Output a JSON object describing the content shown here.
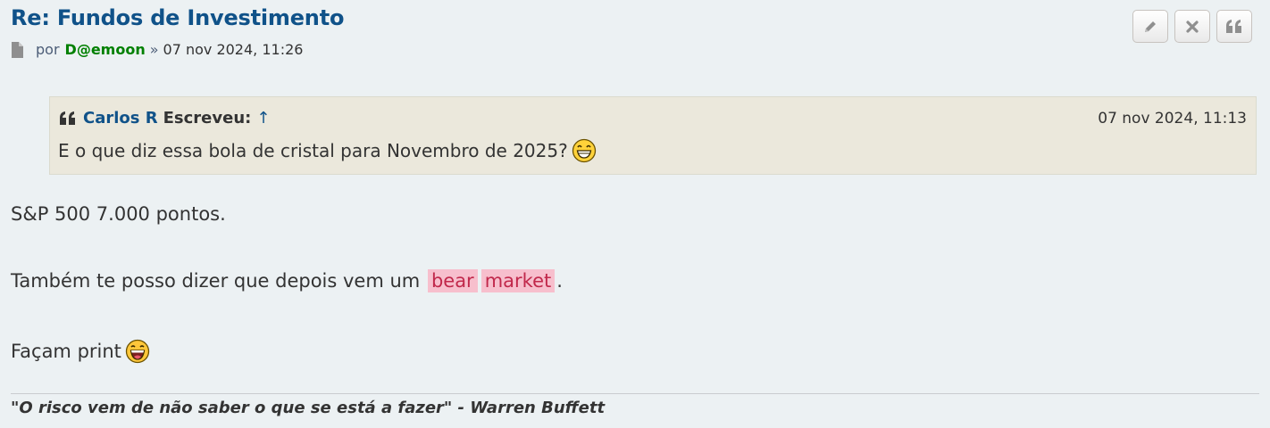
{
  "post": {
    "title": "Re: Fundos de Investimento",
    "meta": {
      "icon": "document-icon",
      "by_label": "por",
      "author": "D@emoon",
      "separator": "»",
      "date": "07 nov 2024, 11:26"
    },
    "actions": [
      {
        "name": "edit",
        "icon": "pencil-icon"
      },
      {
        "name": "delete",
        "icon": "close-icon"
      },
      {
        "name": "quote",
        "icon": "quote-icon"
      }
    ],
    "quote": {
      "icon": "quote-icon",
      "author": "Carlos R",
      "wrote_label": "Escreveu:",
      "arrow": "↑",
      "date": "07 nov 2024, 11:13",
      "text": "E o que diz essa bola de cristal para Novembro de 2025?",
      "smiley": "grin-smiley-icon"
    },
    "body": {
      "line1": "S&P 500 7.000 pontos.",
      "line2_prefix": "Também te posso dizer que depois vem um",
      "highlight1": "bear",
      "highlight2": "market",
      "line2_suffix": ".",
      "line3": "Façam print",
      "line3_smiley": "laughing-smiley-icon"
    },
    "signature": "\"O risco vem de não saber o que se está a fazer\" - Warren Buffett"
  },
  "colors": {
    "background": "#ecf1f3",
    "title": "#105289",
    "author": "#008000",
    "quote_bg": "#ebe8dc",
    "highlight_bg": "#f7bfcd",
    "highlight_text": "#c1284b"
  }
}
